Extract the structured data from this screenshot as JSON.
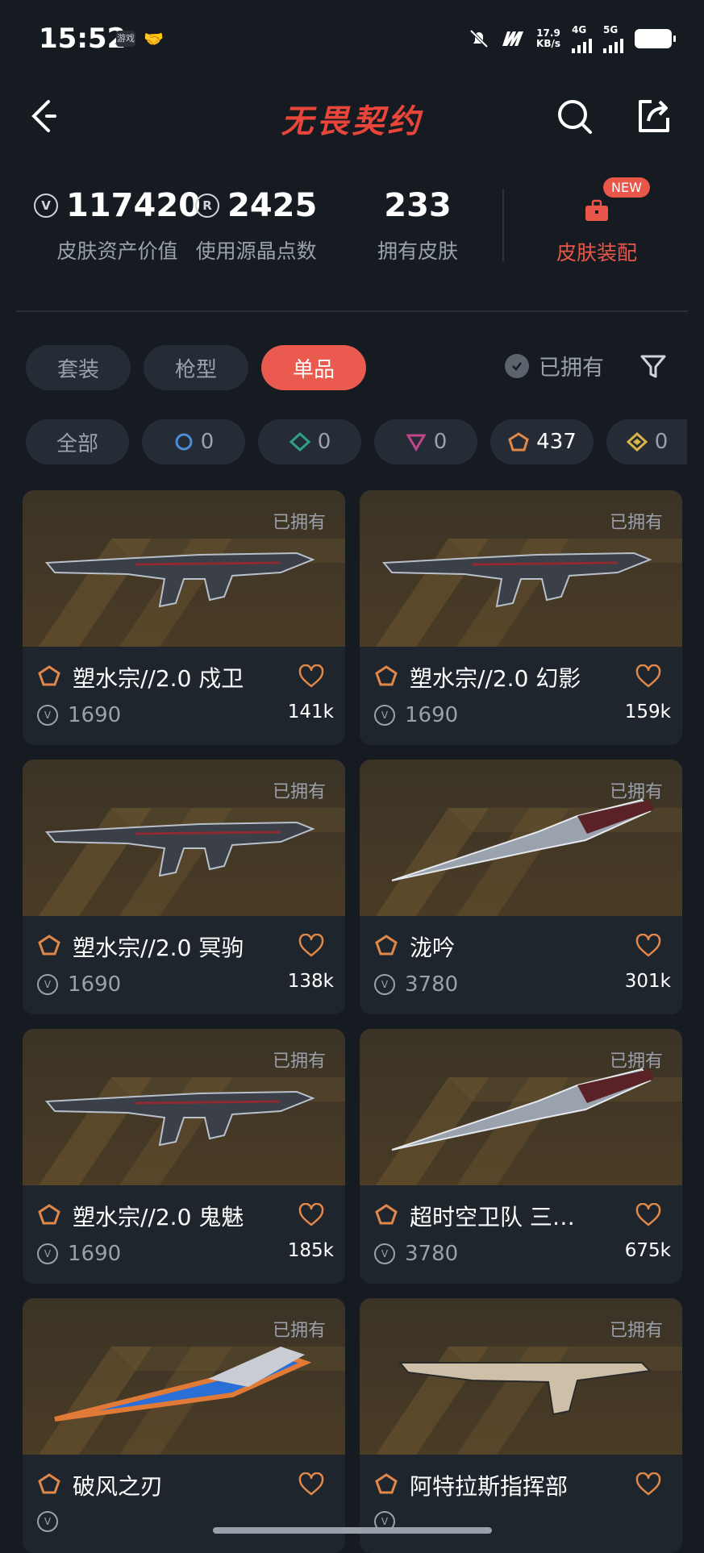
{
  "status_bar": {
    "time": "15:52",
    "app_icon_1": "游戏",
    "speed_value": "17.9",
    "speed_unit": "KB/s",
    "net_4g": "4G",
    "net_5g": "5G"
  },
  "header": {
    "title": "无畏契约"
  },
  "stats": [
    {
      "value": "117420",
      "label": "皮肤资产价值",
      "icon": "vp-coin-icon"
    },
    {
      "value": "2425",
      "label": "使用源晶点数",
      "icon": "radianite-icon"
    },
    {
      "value": "233",
      "label": "拥有皮肤"
    }
  ],
  "equip": {
    "badge": "NEW",
    "label": "皮肤装配"
  },
  "tabs": [
    "套装",
    "枪型",
    "单品"
  ],
  "owned_filter_label": "已拥有",
  "chips": {
    "all": "全部",
    "select_count": "0",
    "deluxe_count": "0",
    "premium_count": "0",
    "exclusive_count": "437",
    "ultra_count": "0"
  },
  "cards": [
    {
      "owned": "已拥有",
      "name": "塑水宗//2.0 戍卫",
      "price": "1690",
      "likes": "141k"
    },
    {
      "owned": "已拥有",
      "name": "塑水宗//2.0 幻影",
      "price": "1690",
      "likes": "159k"
    },
    {
      "owned": "已拥有",
      "name": "塑水宗//2.0 冥驹",
      "price": "1690",
      "likes": "138k"
    },
    {
      "owned": "已拥有",
      "name": "泷吟",
      "price": "3780",
      "likes": "301k"
    },
    {
      "owned": "已拥有",
      "name": "塑水宗//2.0 鬼魅",
      "price": "1690",
      "likes": "185k"
    },
    {
      "owned": "已拥有",
      "name": "超时空卫队 三…",
      "price": "3780",
      "likes": "675k"
    },
    {
      "owned": "已拥有",
      "name": "破风之刃",
      "price": "",
      "likes": ""
    },
    {
      "owned": "已拥有",
      "name": "阿特拉斯指挥部",
      "price": "",
      "likes": ""
    }
  ],
  "colors": {
    "background": "#161b22",
    "accent": "#ea5a4e",
    "card_bg": "#1f252d",
    "tier_exclusive": "#e0874a"
  }
}
